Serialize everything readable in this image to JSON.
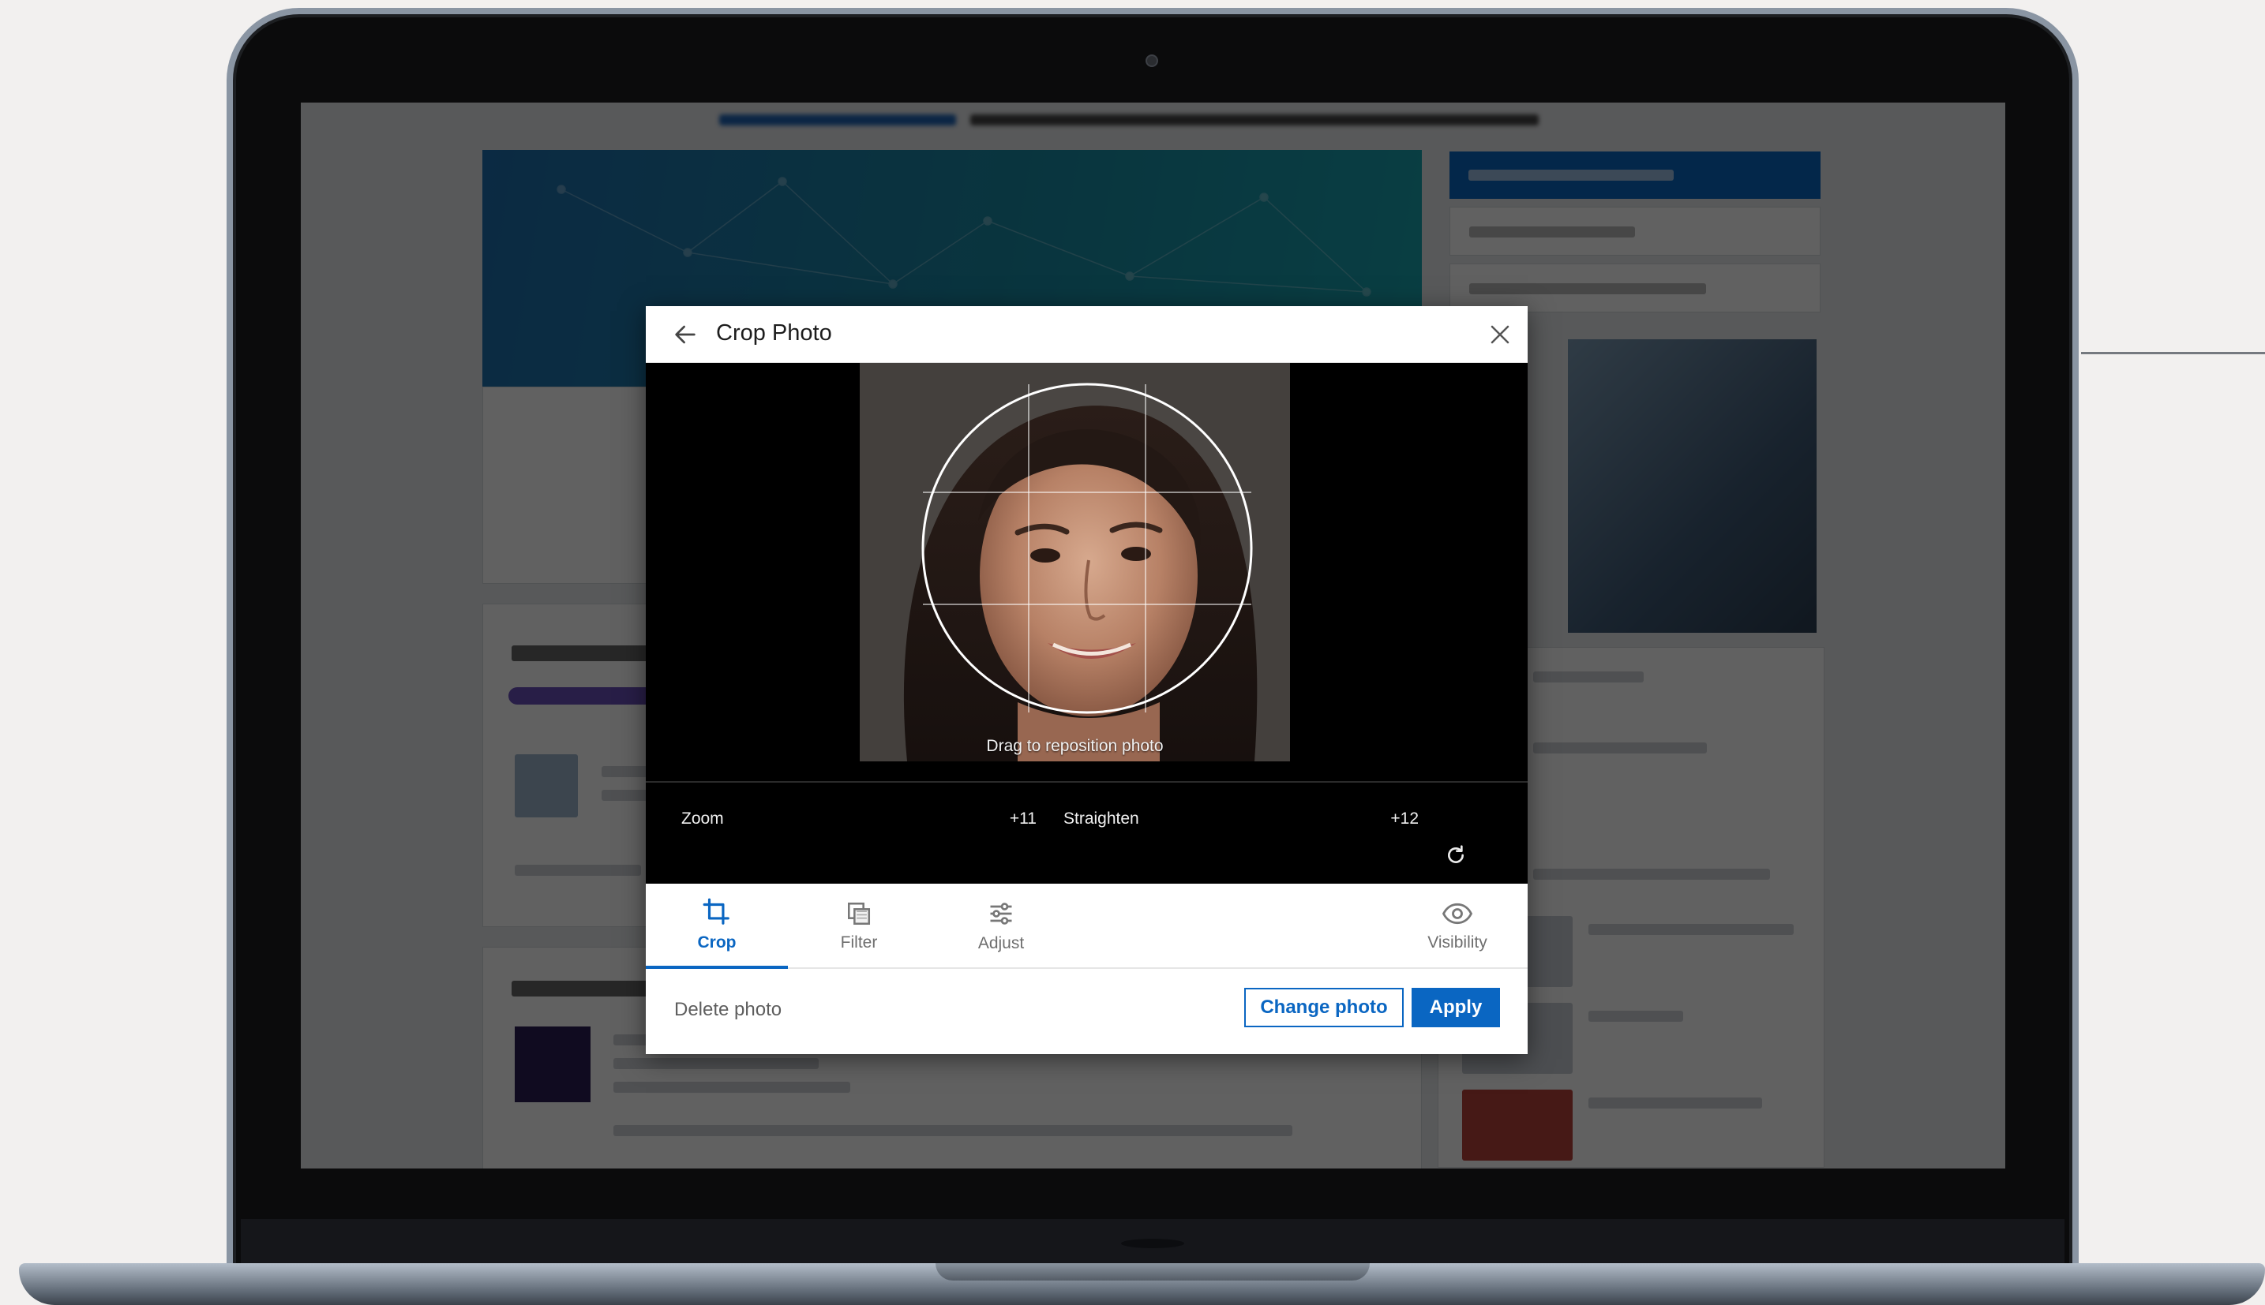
{
  "modal": {
    "title": "Crop Photo",
    "back_icon": "arrow-left-icon",
    "close_icon": "close-icon",
    "photo_hint": "Drag to reposition photo",
    "zoom": {
      "label": "Zoom",
      "value_text": "+11",
      "level": 0.11
    },
    "straighten": {
      "label": "Straighten",
      "value_text": "+12",
      "level": 0.12
    },
    "reset_icon": "rotate-reset-icon",
    "tabs": [
      {
        "label": "Crop",
        "icon": "crop-icon",
        "active": true
      },
      {
        "label": "Filter",
        "icon": "filter-icon",
        "active": false
      },
      {
        "label": "Adjust",
        "icon": "sliders-icon",
        "active": false
      },
      {
        "label": "Visibility",
        "icon": "eye-icon",
        "active": false
      }
    ],
    "footer": {
      "delete_label": "Delete photo",
      "change_label": "Change photo",
      "apply_label": "Apply"
    }
  },
  "colors": {
    "accent": "#0a66c2",
    "overlay": "rgba(0,0,0,0.62)",
    "editor_bg": "#000000"
  }
}
